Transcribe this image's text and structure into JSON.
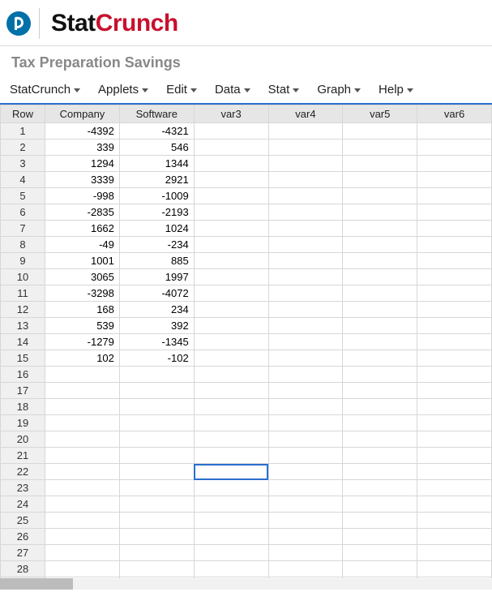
{
  "brand": {
    "part1": "Stat",
    "part2": "Crunch"
  },
  "subtitle": "Tax Preparation Savings",
  "menu": {
    "items": [
      {
        "label": "StatCrunch"
      },
      {
        "label": "Applets"
      },
      {
        "label": "Edit"
      },
      {
        "label": "Data"
      },
      {
        "label": "Stat"
      },
      {
        "label": "Graph"
      },
      {
        "label": "Help"
      }
    ]
  },
  "sheet": {
    "columns": [
      "Row",
      "Company",
      "Software",
      "var3",
      "var4",
      "var5",
      "var6"
    ],
    "row_count": 30,
    "selected": {
      "row": 22,
      "col": 3
    },
    "rows": [
      {
        "Company": "-4392",
        "Software": "-4321"
      },
      {
        "Company": "339",
        "Software": "546"
      },
      {
        "Company": "1294",
        "Software": "1344"
      },
      {
        "Company": "3339",
        "Software": "2921"
      },
      {
        "Company": "-998",
        "Software": "-1009"
      },
      {
        "Company": "-2835",
        "Software": "-2193"
      },
      {
        "Company": "1662",
        "Software": "1024"
      },
      {
        "Company": "-49",
        "Software": "-234"
      },
      {
        "Company": "1001",
        "Software": "885"
      },
      {
        "Company": "3065",
        "Software": "1997"
      },
      {
        "Company": "-3298",
        "Software": "-4072"
      },
      {
        "Company": "168",
        "Software": "234"
      },
      {
        "Company": "539",
        "Software": "392"
      },
      {
        "Company": "-1279",
        "Software": "-1345"
      },
      {
        "Company": "102",
        "Software": "-102"
      }
    ]
  },
  "chart_data": {
    "type": "table",
    "title": "Tax Preparation Savings",
    "columns": [
      "Company",
      "Software"
    ],
    "rows": [
      [
        -4392,
        -4321
      ],
      [
        339,
        546
      ],
      [
        1294,
        1344
      ],
      [
        3339,
        2921
      ],
      [
        -998,
        -1009
      ],
      [
        -2835,
        -2193
      ],
      [
        1662,
        1024
      ],
      [
        -49,
        -234
      ],
      [
        1001,
        885
      ],
      [
        3065,
        1997
      ],
      [
        -3298,
        -4072
      ],
      [
        168,
        234
      ],
      [
        539,
        392
      ],
      [
        -1279,
        -1345
      ],
      [
        102,
        -102
      ]
    ]
  }
}
